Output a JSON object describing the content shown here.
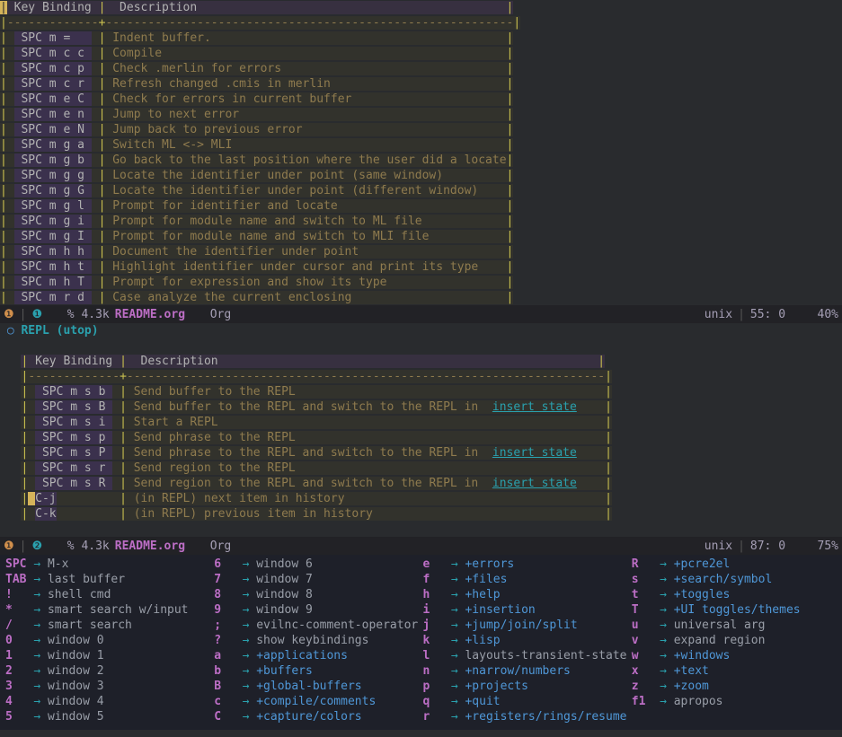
{
  "pane1": {
    "header": {
      "col1": "Key Binding",
      "col2": "Description"
    },
    "rows": [
      {
        "key": "SPC m =  ",
        "desc": "Indent buffer."
      },
      {
        "key": "SPC m c c",
        "desc": "Compile"
      },
      {
        "key": "SPC m c p",
        "desc": "Check .merlin for errors"
      },
      {
        "key": "SPC m c r",
        "desc": "Refresh changed .cmis in merlin"
      },
      {
        "key": "SPC m e C",
        "desc": "Check for errors in current buffer"
      },
      {
        "key": "SPC m e n",
        "desc": "Jump to next error"
      },
      {
        "key": "SPC m e N",
        "desc": "Jump back to previous error"
      },
      {
        "key": "SPC m g a",
        "desc": "Switch ML <-> MLI"
      },
      {
        "key": "SPC m g b",
        "desc": "Go back to the last position where the user did a locate"
      },
      {
        "key": "SPC m g g",
        "desc": "Locate the identifier under point (same window)"
      },
      {
        "key": "SPC m g G",
        "desc": "Locate the identifier under point (different window)"
      },
      {
        "key": "SPC m g l",
        "desc": "Prompt for identifier and locate"
      },
      {
        "key": "SPC m g i",
        "desc": "Prompt for module name and switch to ML file"
      },
      {
        "key": "SPC m g I",
        "desc": "Prompt for module name and switch to MLI file"
      },
      {
        "key": "SPC m h h",
        "desc": "Document the identifier under point"
      },
      {
        "key": "SPC m h t",
        "desc": "Highlight identifier under cursor and print its type"
      },
      {
        "key": "SPC m h T",
        "desc": "Prompt for expression and show its type"
      },
      {
        "key": "SPC m r d",
        "desc": "Case analyze the current enclosing"
      }
    ]
  },
  "modeline1": {
    "warn": "❶",
    "info": "❶",
    "pct": "% 4.3k",
    "fname": "README.org",
    "mode": "Org",
    "enc": "unix",
    "line": "55: 0",
    "scroll": "40%"
  },
  "section2": {
    "title": "REPL (utop)"
  },
  "pane2": {
    "header": {
      "col1": "Key Binding",
      "col2": "Description"
    },
    "rows": [
      {
        "key": "SPC m s b",
        "desc": "Send buffer to the REPL"
      },
      {
        "key": "SPC m s B",
        "desc": "Send buffer to the REPL and switch to the REPL in ",
        "link": "insert state"
      },
      {
        "key": "SPC m s i",
        "desc": "Start a REPL"
      },
      {
        "key": "SPC m s p",
        "desc": "Send phrase to the REPL"
      },
      {
        "key": "SPC m s P",
        "desc": "Send phrase to the REPL and switch to the REPL in ",
        "link": "insert state"
      },
      {
        "key": "SPC m s r",
        "desc": "Send region to the REPL"
      },
      {
        "key": "SPC m s R",
        "desc": "Send region to the REPL and switch to the REPL in ",
        "link": "insert state"
      },
      {
        "key": "C-j",
        "desc": "(in REPL) next item in history",
        "plainkey": true
      },
      {
        "key": "C-k",
        "desc": "(in REPL) previous item in history",
        "plainkey": true
      }
    ]
  },
  "modeline2": {
    "warn": "❶",
    "info": "❷",
    "pct": "% 4.3k",
    "fname": "README.org",
    "mode": "Org",
    "enc": "unix",
    "line": "87: 0",
    "scroll": "75%"
  },
  "whichkey": {
    "cols": [
      [
        {
          "key": "SPC",
          "label": "M-x",
          "prefix": false
        },
        {
          "key": "TAB",
          "label": "last buffer",
          "prefix": false
        },
        {
          "key": "!",
          "label": "shell cmd",
          "prefix": false
        },
        {
          "key": "*",
          "label": "smart search w/input",
          "prefix": false
        },
        {
          "key": "/",
          "label": "smart search",
          "prefix": false
        },
        {
          "key": "0",
          "label": "window 0",
          "prefix": false
        },
        {
          "key": "1",
          "label": "window 1",
          "prefix": false
        },
        {
          "key": "2",
          "label": "window 2",
          "prefix": false
        },
        {
          "key": "3",
          "label": "window 3",
          "prefix": false
        },
        {
          "key": "4",
          "label": "window 4",
          "prefix": false
        },
        {
          "key": "5",
          "label": "window 5",
          "prefix": false
        }
      ],
      [
        {
          "key": "6",
          "label": "window 6",
          "prefix": false
        },
        {
          "key": "7",
          "label": "window 7",
          "prefix": false
        },
        {
          "key": "8",
          "label": "window 8",
          "prefix": false
        },
        {
          "key": "9",
          "label": "window 9",
          "prefix": false
        },
        {
          "key": ";",
          "label": "evilnc-comment-operator",
          "prefix": false
        },
        {
          "key": "?",
          "label": "show keybindings",
          "prefix": false
        },
        {
          "key": "a",
          "label": "+applications",
          "prefix": true
        },
        {
          "key": "b",
          "label": "+buffers",
          "prefix": true
        },
        {
          "key": "B",
          "label": "+global-buffers",
          "prefix": true
        },
        {
          "key": "c",
          "label": "+compile/comments",
          "prefix": true
        },
        {
          "key": "C",
          "label": "+capture/colors",
          "prefix": true
        }
      ],
      [
        {
          "key": "e",
          "label": "+errors",
          "prefix": true
        },
        {
          "key": "f",
          "label": "+files",
          "prefix": true
        },
        {
          "key": "h",
          "label": "+help",
          "prefix": true
        },
        {
          "key": "i",
          "label": "+insertion",
          "prefix": true
        },
        {
          "key": "j",
          "label": "+jump/join/split",
          "prefix": true
        },
        {
          "key": "k",
          "label": "+lisp",
          "prefix": true
        },
        {
          "key": "l",
          "label": "layouts-transient-state",
          "prefix": false
        },
        {
          "key": "n",
          "label": "+narrow/numbers",
          "prefix": true
        },
        {
          "key": "p",
          "label": "+projects",
          "prefix": true
        },
        {
          "key": "q",
          "label": "+quit",
          "prefix": true
        },
        {
          "key": "r",
          "label": "+registers/rings/resume",
          "prefix": true
        }
      ],
      [
        {
          "key": "R",
          "label": "+pcre2el",
          "prefix": true
        },
        {
          "key": "s",
          "label": "+search/symbol",
          "prefix": true
        },
        {
          "key": "t",
          "label": "+toggles",
          "prefix": true
        },
        {
          "key": "T",
          "label": "+UI toggles/themes",
          "prefix": true
        },
        {
          "key": "u",
          "label": "universal arg",
          "prefix": false
        },
        {
          "key": "v",
          "label": "expand region",
          "prefix": false
        },
        {
          "key": "w",
          "label": "+windows",
          "prefix": true
        },
        {
          "key": "x",
          "label": "+text",
          "prefix": true
        },
        {
          "key": "z",
          "label": "+zoom",
          "prefix": true
        },
        {
          "key": "f1",
          "label": "apropos",
          "prefix": false
        }
      ]
    ]
  }
}
